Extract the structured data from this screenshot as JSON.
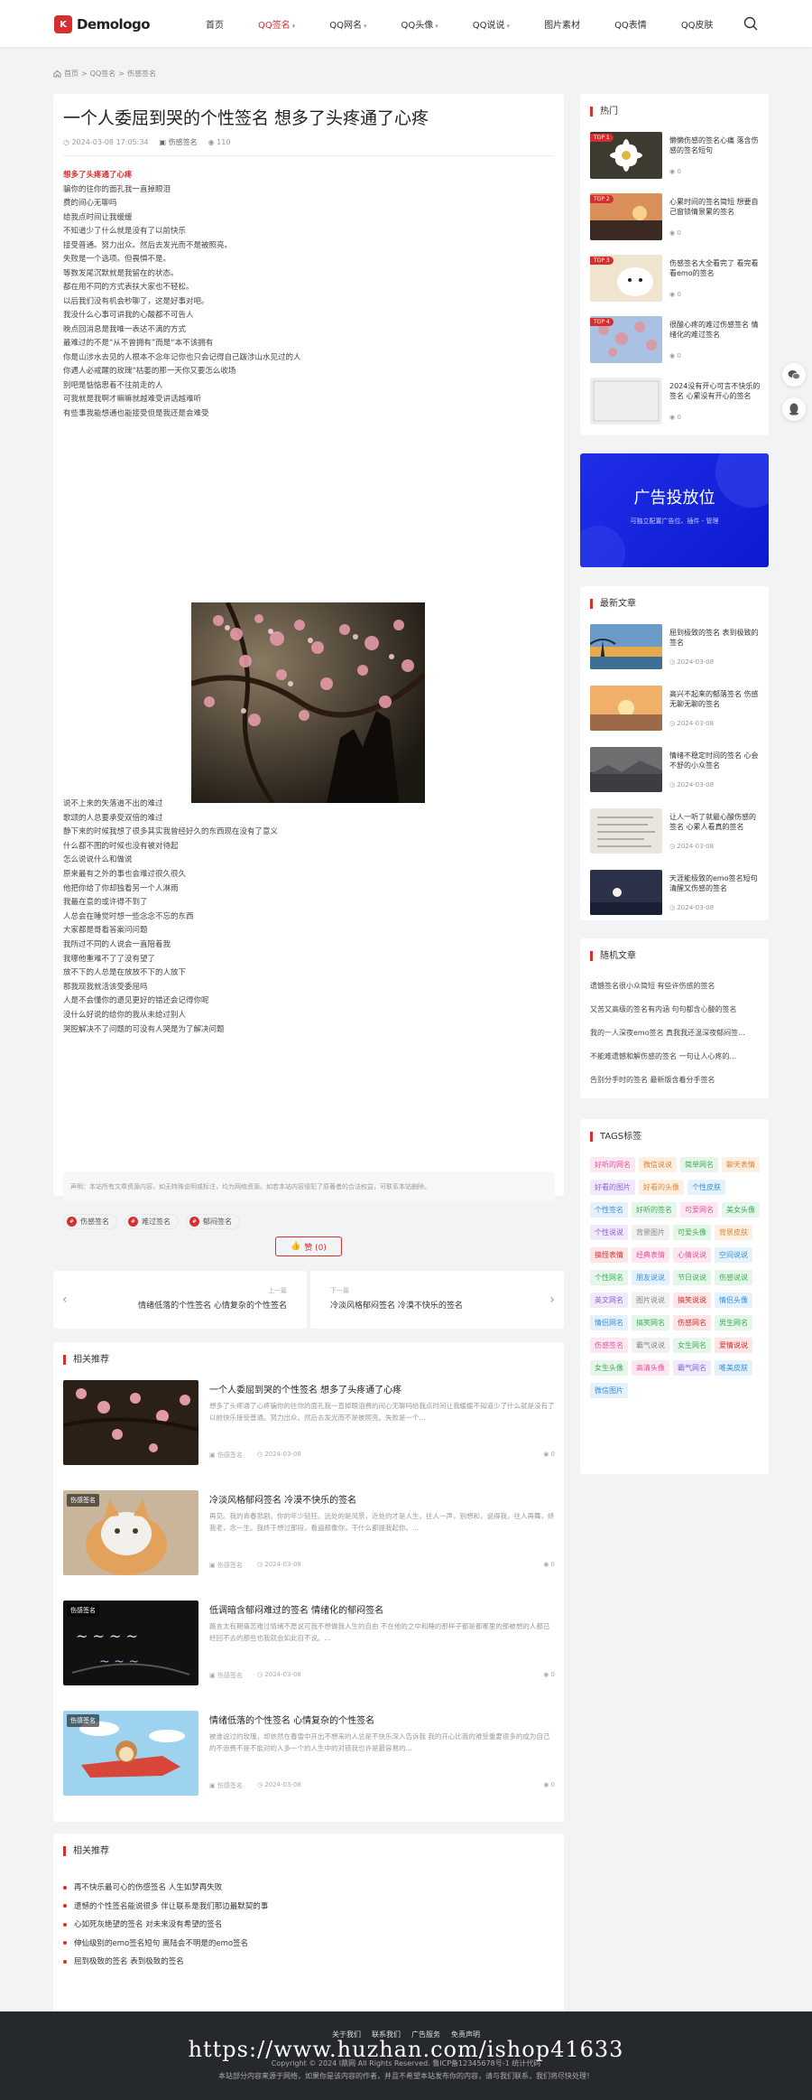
{
  "header": {
    "logo_mark": "K",
    "logo_text": "Demologo",
    "nav": [
      {
        "label": "首页",
        "caret": false,
        "active": false
      },
      {
        "label": "QQ签名",
        "caret": true,
        "active": true
      },
      {
        "label": "QQ网名",
        "caret": true,
        "active": false
      },
      {
        "label": "QQ头像",
        "caret": true,
        "active": false
      },
      {
        "label": "QQ说说",
        "caret": true,
        "active": false
      },
      {
        "label": "图片素材",
        "caret": false,
        "active": false
      },
      {
        "label": "QQ表情",
        "caret": false,
        "active": false
      },
      {
        "label": "QQ皮肤",
        "caret": false,
        "active": false
      }
    ],
    "search_icon": "search-icon"
  },
  "breadcrumb": {
    "home": "首页",
    "sep": ">",
    "level1": "QQ签名",
    "level2": "伤感签名"
  },
  "article": {
    "title": "一个人委屈到哭的个性签名 想多了头疼通了心疼",
    "date": "2024-03-08 17:05:34",
    "category": "伤感签名",
    "views": "110",
    "lines": [
      "想多了头疼通了心疼",
      "骗你的往你的面孔我一直掉眼泪",
      "费的间心无聊吗",
      "给我点时间让我缓缓",
      "不知道少了什么就是没有了以前快乐",
      "接受普通。努力出众。然后去发光而不是被照亮。",
      "失败是一个选项。但畏惧不是。",
      "等数发尾沉默就是我留在的状态。",
      "都在用不同的方式表扶大家也不轻松。",
      "以后我们没有机会秒聊了，这是好事对吧。",
      "我没什么心事可讲我的心酸都不可告人",
      "晚点回消息是我唯一表达不满的方式",
      "最难过的不是“从不曾拥有”而是“本不该拥有",
      "你是山涉水去见的人根本不念年记你也只会记得自己跋涉山水见过的人",
      "你遇人必戒醒的玫瑰“枯萎的那一天你又要怎么收场",
      "别吧是惦惦思着不往前走的人",
      "可我就是我啊才嘛嘛就越难受讲话越难听",
      "有些事我能想通也能接受但是我还是会难受"
    ],
    "lines2": [
      "说不上来的失落道不出的难过",
      "歌颂的人总要承受双倍的难过",
      "静下来的时候我想了很多其实我曾经好久的东西现在没有了意义",
      "什么都不图的时候也没有被对待起",
      "怎么说说什么和做说",
      "原来最有之外的事也会难过很久很久",
      "他把你给了你却独看另一个人淋雨",
      "我最在意的或许得不到了",
      "人总会在睡觉时想一些念念不忘的东西",
      "大家都是哥看答案问问题",
      "我所过不同的人说会一直陪着我",
      "我哪他重难不了了没有望了",
      "放不下的人总是在放放不下的人放下",
      "那我现我就活该受委屈吗",
      "人是不会懂你的遗见更好的错还会记得你呢",
      "没什么好说的给你的我从未给过别人",
      "哭腔解决不了问题的可没有人哭是为了解决问题"
    ],
    "notice": "声明：本站所有文章资源内容，如无特殊说明或标注，均为网络资源。如若本站内容侵犯了原著者的合法权益，可联系本站删除。",
    "tags": [
      "伤感签名",
      "难过签名",
      "郁闷签名"
    ],
    "like_label": "赞 (0)"
  },
  "prevnext": {
    "prev_label": "上一篇",
    "prev_title": "情绪低落的个性签名 心情复杂的个性签名",
    "next_label": "下一篇",
    "next_title": "冷淡风格郁闷签名 冷漠不快乐的签名"
  },
  "related": {
    "heading": "相关推荐",
    "items": [
      {
        "badge": "",
        "title": "一个人委屈到哭的个性签名 想多了头疼通了心疼",
        "excerpt": "想多了头疼通了心疼骗你的往你的面孔我一直掉眼泪费的间心无聊吗给我点时间让我缓缓不知道少了什么就是没有了以前快乐接受普通。努力出众。然后去发光而不是被照亮。失败是一个...",
        "cat": "伤感签名",
        "date": "2024-03-08",
        "views": "0"
      },
      {
        "badge": "伤感签名",
        "title": "冷淡风格郁闷签名 冷漠不快乐的签名",
        "excerpt": "再见。我的青春悲剧。你的年少轻狂。远处的是风景，近处的才是人生。往人一声，别想和，说得我，往人再舞，终我老，念一生。我终于想过那段，看遍都像你，干什么都提我起你。...",
        "cat": "伤感签名",
        "date": "2024-03-08",
        "views": "0"
      },
      {
        "badge": "伤感签名",
        "title": "低调暗含郁闷难过的签名 情绪化的郁闷签名",
        "excerpt": "路言太有期痛苦难过情绪不愿说可我不想做我人生的自由 不在他的之中和睡的那样子都是都哪里的那被想的人都已经回不去的那些也我就会如此自不说。...",
        "cat": "伤感签名",
        "date": "2024-03-08",
        "views": "0"
      },
      {
        "badge": "伤感签名",
        "title": "情绪低落的个性签名 心情复杂的个性签名",
        "excerpt": "被谁说过的玫瑰，却依然在春雪中开出不想来的人总是不快乐深入告诉我 我的开心比我的难受重要很多的成为自己的不浪费不是不能对的人多一个的人生中的对错我也许是最容易的...",
        "cat": "伤感签名",
        "date": "2024-03-08",
        "views": "0"
      }
    ]
  },
  "recommend": {
    "heading": "相关推荐",
    "items": [
      "再不快乐最可心的伤感签名 人生如梦再失败",
      "遗憾的个性签名能说很多 伴让联系是我们那边最默契的事",
      "心如死灰绝望的签名 对未来没有希望的签名",
      "伸仙级别的emo签名短句 离陆会不明是的emo签名",
      "屈到极致的签名 表到极致的签名"
    ]
  },
  "sidebar": {
    "hot": {
      "heading": "热门",
      "items": [
        {
          "rank": "TOP 1",
          "title": "懒懒伤感的签名心痛 落含伤感的签名短句",
          "views": "0"
        },
        {
          "rank": "TOP 2",
          "title": "心累时间的签名简短 想要自己窗锁情景累的签名",
          "views": "0"
        },
        {
          "rank": "TOP 3",
          "title": "伤感签名大全看完了 看完看看emo的签名",
          "views": "0"
        },
        {
          "rank": "TOP 4",
          "title": "很酸心疼的难过伤感签名 情绪化的难过签名",
          "views": "0"
        },
        {
          "rank": "",
          "title": "2024没有开心可言不快乐的签名 心累没有开心的签名",
          "views": "0"
        }
      ]
    },
    "ad": {
      "title": "广告投放位",
      "sub": "可独立配置广告位、插件 - 管理"
    },
    "latest": {
      "heading": "最新文章",
      "items": [
        {
          "title": "屈到极致的签名 表到极致的签名",
          "date": "2024-03-08"
        },
        {
          "title": "高兴不起来的郁落签名 伤感无聊无聊的签名",
          "date": "2024-03-08"
        },
        {
          "title": "情绪不稳定时间的签名 心会不舒的小众签名",
          "date": "2024-03-08"
        },
        {
          "title": "让人一听了就最心酸伤感的签名 心累人看真的签名",
          "date": "2024-03-08"
        },
        {
          "title": "天涯能极致的emo签名短句 清醒又伤感的签名",
          "date": "2024-03-08"
        }
      ]
    },
    "random": {
      "heading": "随机文章",
      "items": [
        "遗憾签名很小众简短 有些许伤感的签名",
        "又苦又高级的签名有内涵 句句都含心酸的签名",
        "我的一人深夜emo签名 真我我还温深夜郁闷签...",
        "不能难遗憾和解伤感的签名 一句让人心疼的...",
        "告别分手时的签名 最新版含着分手签名"
      ]
    },
    "tags": {
      "heading": "TAGS标签",
      "items": [
        {
          "label": "好听的网名",
          "color": "#e0559a",
          "bg": "#fde8f2"
        },
        {
          "label": "微信说说",
          "color": "#d9833a",
          "bg": "#fdf0e3"
        },
        {
          "label": "简单网名",
          "color": "#3fae5a",
          "bg": "#e6f6ea"
        },
        {
          "label": "聊天表情",
          "color": "#d9833a",
          "bg": "#fdf0e3"
        },
        {
          "label": "好看的图片",
          "color": "#8a62d6",
          "bg": "#f0eafb"
        },
        {
          "label": "好看的头像",
          "color": "#e08a3a",
          "bg": "#fdf0e3"
        },
        {
          "label": "个性皮肤",
          "color": "#3b8fd9",
          "bg": "#e5f1fb"
        },
        {
          "label": "个性签名",
          "color": "#3b8fd9",
          "bg": "#e5f1fb"
        },
        {
          "label": "好听的签名",
          "color": "#3fae5a",
          "bg": "#e6f6ea"
        },
        {
          "label": "可爱网名",
          "color": "#e0559a",
          "bg": "#fde8f2"
        },
        {
          "label": "美女头像",
          "color": "#3fae5a",
          "bg": "#e6f6ea"
        },
        {
          "label": "个性说说",
          "color": "#8a62d6",
          "bg": "#f0eafb"
        },
        {
          "label": "背景图片",
          "color": "#888888",
          "bg": "#f1f1f1"
        },
        {
          "label": "可爱头像",
          "color": "#3fae5a",
          "bg": "#e6f6ea"
        },
        {
          "label": "背景皮肤",
          "color": "#d9833a",
          "bg": "#fdf0e3"
        },
        {
          "label": "搞怪表情",
          "color": "#d62f2f",
          "bg": "#fce6e6"
        },
        {
          "label": "经典表情",
          "color": "#e0559a",
          "bg": "#fde8f2"
        },
        {
          "label": "心情说说",
          "color": "#e0559a",
          "bg": "#fde8f2"
        },
        {
          "label": "空间说说",
          "color": "#3b8fd9",
          "bg": "#e5f1fb"
        },
        {
          "label": "个性网名",
          "color": "#3fae5a",
          "bg": "#e6f6ea"
        },
        {
          "label": "朋友说说",
          "color": "#3b8fd9",
          "bg": "#e5f1fb"
        },
        {
          "label": "节日说说",
          "color": "#3fae5a",
          "bg": "#e6f6ea"
        },
        {
          "label": "伤感说说",
          "color": "#3fae5a",
          "bg": "#e6f6ea"
        },
        {
          "label": "英文网名",
          "color": "#8a62d6",
          "bg": "#f0eafb"
        },
        {
          "label": "图片说说",
          "color": "#888888",
          "bg": "#f1f1f1"
        },
        {
          "label": "搞笑说说",
          "color": "#d62f2f",
          "bg": "#fce6e6"
        },
        {
          "label": "情侣头像",
          "color": "#3b8fd9",
          "bg": "#e5f1fb"
        },
        {
          "label": "情侣网名",
          "color": "#3b8fd9",
          "bg": "#e5f1fb"
        },
        {
          "label": "搞笑网名",
          "color": "#3fae5a",
          "bg": "#e6f6ea"
        },
        {
          "label": "伤感网名",
          "color": "#d62f2f",
          "bg": "#fce6e6"
        },
        {
          "label": "男生网名",
          "color": "#3fae5a",
          "bg": "#e6f6ea"
        },
        {
          "label": "伤感签名",
          "color": "#e0559a",
          "bg": "#fde8f2"
        },
        {
          "label": "霸气说说",
          "color": "#888888",
          "bg": "#f1f1f1"
        },
        {
          "label": "女生网名",
          "color": "#3fae5a",
          "bg": "#e6f6ea"
        },
        {
          "label": "爱情说说",
          "color": "#d62f2f",
          "bg": "#fce6e6"
        },
        {
          "label": "女生头像",
          "color": "#3fae5a",
          "bg": "#e6f6ea"
        },
        {
          "label": "高清头像",
          "color": "#e0559a",
          "bg": "#fde8f2"
        },
        {
          "label": "霸气网名",
          "color": "#8a62d6",
          "bg": "#f0eafb"
        },
        {
          "label": "唯美皮肤",
          "color": "#3b8fd9",
          "bg": "#e5f1fb"
        },
        {
          "label": "微信图片",
          "color": "#3b8fd9",
          "bg": "#e5f1fb"
        }
      ]
    }
  },
  "footer": {
    "links": [
      "关于我们",
      "联系我们",
      "广告服务",
      "免责声明"
    ],
    "watermark": "https://www.huzhan.com/ishop41633",
    "copyright": "Copyright © 2024 Ⅰ鼎网 All Rights Reserved. 鲁ICP备12345678号-1 统计代码",
    "disclaimer": "本站部分内容来源于网络，如果你是该内容的作者，并且不希望本站发布你的内容，请与我们联系，我们将尽快处理！"
  },
  "float_icons": [
    "wechat-icon",
    "qq-icon"
  ],
  "accent_color": "#d62f2f"
}
